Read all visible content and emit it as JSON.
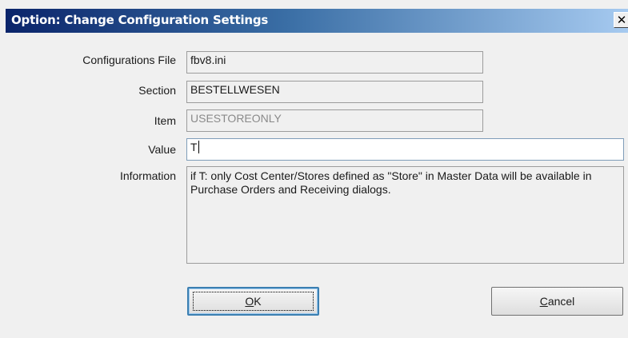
{
  "window": {
    "title": "Option: Change Configuration Settings",
    "close_glyph": "✕"
  },
  "form": {
    "config_file_label": "Configurations File",
    "config_file_value": "fbv8.ini",
    "section_label": "Section",
    "section_value": "BESTELLWESEN",
    "item_label": "Item",
    "item_value": "USESTOREONLY",
    "value_label": "Value",
    "value_value": "T",
    "info_label": "Information",
    "info_value": "if T: only Cost Center/Stores defined as \"Store\" in Master Data will be available in Purchase Orders and Receiving dialogs."
  },
  "buttons": {
    "ok_label": "OK",
    "ok_accel": "O",
    "cancel_label": "Cancel",
    "cancel_accel": "C"
  },
  "colors": {
    "titlebar_start": "#0a246a",
    "titlebar_end": "#a6caf0",
    "dialog_bg": "#f0f0f0"
  }
}
